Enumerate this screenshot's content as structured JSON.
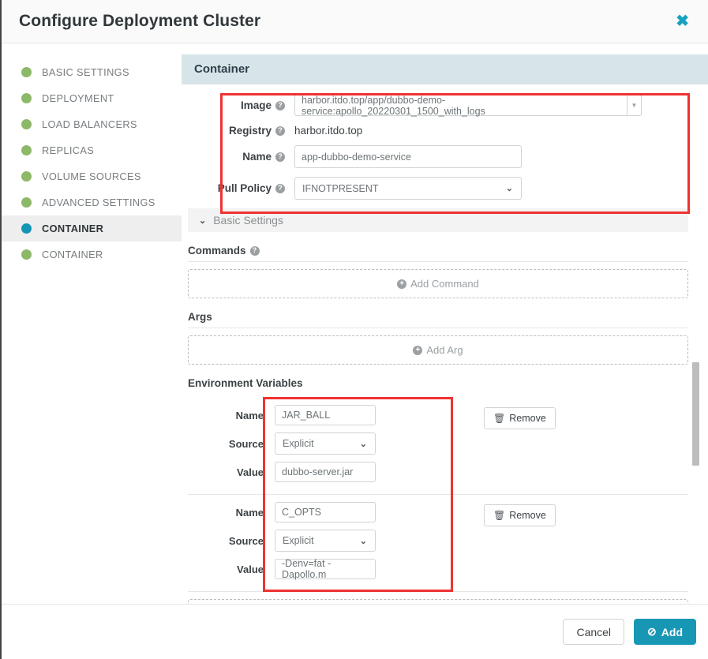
{
  "header": {
    "title": "Configure Deployment Cluster",
    "close_icon": "close-icon",
    "close_glyph": "✖"
  },
  "sidebar": {
    "items": [
      {
        "label": "BASIC SETTINGS",
        "state": "complete"
      },
      {
        "label": "DEPLOYMENT",
        "state": "complete"
      },
      {
        "label": "LOAD BALANCERS",
        "state": "complete"
      },
      {
        "label": "REPLICAS",
        "state": "complete"
      },
      {
        "label": "VOLUME SOURCES",
        "state": "complete"
      },
      {
        "label": "ADVANCED SETTINGS",
        "state": "complete"
      },
      {
        "label": "CONTAINER",
        "state": "active"
      },
      {
        "label": "CONTAINER",
        "state": "complete"
      }
    ]
  },
  "panel": {
    "title": "Container",
    "fields": {
      "image": {
        "label": "Image",
        "value": "harbor.itdo.top/app/dubbo-demo-service:apollo_20220301_1500_with_logs",
        "toggle_icon": "chevron-down-icon",
        "toggle_glyph": "▼"
      },
      "registry": {
        "label": "Registry",
        "value": "harbor.itdo.top"
      },
      "name": {
        "label": "Name",
        "value": "app-dubbo-demo-service"
      },
      "pull_policy": {
        "label": "Pull Policy",
        "value": "IFNOTPRESENT",
        "chevron_glyph": "⌄"
      }
    },
    "help_glyph": "?",
    "basic_settings": {
      "label": "Basic Settings",
      "chevron_glyph": "⌄"
    },
    "commands": {
      "title": "Commands",
      "add_label": "Add Command",
      "plus_glyph": "+"
    },
    "args": {
      "title": "Args",
      "add_label": "Add Arg",
      "plus_glyph": "+"
    },
    "environment_variables": {
      "title": "Environment Variables",
      "labels": {
        "name": "Name",
        "source": "Source",
        "value": "Value"
      },
      "remove_label": "Remove",
      "trash_glyph": "🗑",
      "chevron_glyph": "⌄",
      "items": [
        {
          "name": "JAR_BALL",
          "source": "Explicit",
          "value": "dubbo-server.jar"
        },
        {
          "name": "C_OPTS",
          "source": "Explicit",
          "value": "-Denv=fat -Dapollo.m"
        }
      ]
    }
  },
  "footer": {
    "cancel_label": "Cancel",
    "add_label": "Add",
    "add_check_glyph": "⊘"
  },
  "colors": {
    "accent_teal": "#1897b5",
    "complete_green": "#8cb867",
    "highlight_red": "#ef3232",
    "panel_head_bg": "#d7e5e8"
  }
}
